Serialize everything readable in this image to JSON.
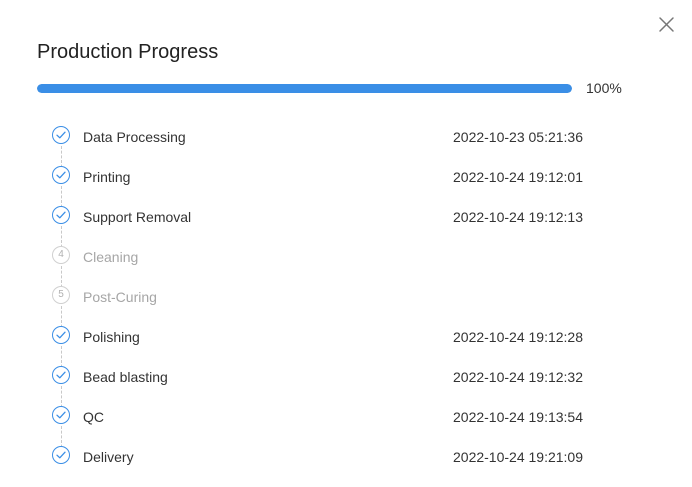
{
  "dialog": {
    "title": "Production Progress",
    "close_icon": "close-icon"
  },
  "progress": {
    "value": 1.0,
    "label": "100%",
    "color": "#3a8ee6"
  },
  "steps": [
    {
      "number": "1",
      "label": "Data Processing",
      "time": "2022-10-23 05:21:36",
      "status": "done",
      "icon": "check-icon"
    },
    {
      "number": "2",
      "label": "Printing",
      "time": "2022-10-24 19:12:01",
      "status": "done",
      "icon": "check-icon"
    },
    {
      "number": "3",
      "label": "Support Removal",
      "time": "2022-10-24 19:12:13",
      "status": "done",
      "icon": "check-icon"
    },
    {
      "number": "4",
      "label": "Cleaning",
      "time": "",
      "status": "pending",
      "icon": "step-number-icon"
    },
    {
      "number": "5",
      "label": "Post-Curing",
      "time": "",
      "status": "pending",
      "icon": "step-number-icon"
    },
    {
      "number": "6",
      "label": "Polishing",
      "time": "2022-10-24 19:12:28",
      "status": "done",
      "icon": "check-icon"
    },
    {
      "number": "7",
      "label": "Bead blasting",
      "time": "2022-10-24 19:12:32",
      "status": "done",
      "icon": "check-icon"
    },
    {
      "number": "8",
      "label": "QC",
      "time": "2022-10-24 19:13:54",
      "status": "done",
      "icon": "check-icon"
    },
    {
      "number": "9",
      "label": "Delivery",
      "time": "2022-10-24 19:21:09",
      "status": "done",
      "icon": "check-icon"
    }
  ]
}
